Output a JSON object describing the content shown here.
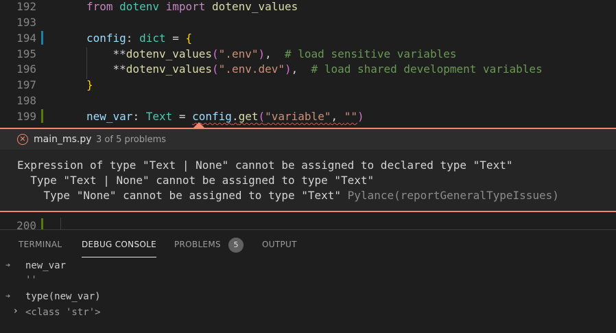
{
  "editor": {
    "lines": [
      {
        "num": "192",
        "tokens": [
          {
            "t": "from",
            "c": "kw"
          },
          {
            "t": " "
          },
          {
            "t": "dotenv",
            "c": "mod"
          },
          {
            "t": " "
          },
          {
            "t": "import",
            "c": "kw"
          },
          {
            "t": " "
          },
          {
            "t": "dotenv_values",
            "c": "fn"
          }
        ]
      },
      {
        "num": "193",
        "tokens": []
      },
      {
        "num": "194",
        "tokens": [
          {
            "t": "config",
            "c": "var"
          },
          {
            "t": ": "
          },
          {
            "t": "dict",
            "c": "mod"
          },
          {
            "t": " = "
          },
          {
            "t": "{",
            "c": "brace"
          }
        ]
      },
      {
        "num": "195",
        "tokens": [
          {
            "t": "    **"
          },
          {
            "t": "dotenv_values",
            "c": "fn"
          },
          {
            "t": "(",
            "c": "paren"
          },
          {
            "t": "\".env\"",
            "c": "str"
          },
          {
            "t": ")",
            "c": "paren"
          },
          {
            "t": ",  "
          },
          {
            "t": "# load sensitive variables",
            "c": "cmt"
          }
        ]
      },
      {
        "num": "196",
        "tokens": [
          {
            "t": "    **"
          },
          {
            "t": "dotenv_values",
            "c": "fn"
          },
          {
            "t": "(",
            "c": "paren"
          },
          {
            "t": "\".env.dev\"",
            "c": "str"
          },
          {
            "t": ")",
            "c": "paren"
          },
          {
            "t": ",  "
          },
          {
            "t": "# load shared development variables",
            "c": "cmt"
          }
        ]
      },
      {
        "num": "197",
        "tokens": [
          {
            "t": "}",
            "c": "brace"
          }
        ]
      },
      {
        "num": "198",
        "tokens": []
      },
      {
        "num": "199",
        "tokens": [
          {
            "t": "new_var",
            "c": "var"
          },
          {
            "t": ": "
          },
          {
            "t": "Text",
            "c": "mod"
          },
          {
            "t": " = "
          },
          {
            "t": "config",
            "c": "var squiggle"
          },
          {
            "t": ".",
            "c": "op squiggle"
          },
          {
            "t": "get",
            "c": "fn squiggle"
          },
          {
            "t": "(",
            "c": "paren squiggle"
          },
          {
            "t": "\"variable\"",
            "c": "str squiggle"
          },
          {
            "t": ", ",
            "c": "op squiggle"
          },
          {
            "t": "\"\"",
            "c": "str squiggle"
          },
          {
            "t": ")",
            "c": "paren"
          }
        ]
      }
    ],
    "line_after_peek": "200"
  },
  "peek": {
    "file": "main_ms.py",
    "count": "3 of 5 problems",
    "messages": [
      "Expression of type \"Text | None\" cannot be assigned to declared type \"Text\"",
      "  Type \"Text | None\" cannot be assigned to type \"Text\"",
      "    Type \"None\" cannot be assigned to type \"Text\""
    ],
    "source": "Pylance(reportGeneralTypeIssues)",
    "icon": "error-circle-icon"
  },
  "panel": {
    "tabs": [
      {
        "label": "TERMINAL"
      },
      {
        "label": "DEBUG CONSOLE"
      },
      {
        "label": "PROBLEMS"
      },
      {
        "label": "OUTPUT"
      }
    ],
    "problems_badge": "5",
    "console": [
      {
        "input": "new_var",
        "output": "''"
      },
      {
        "input": "type(new_var)",
        "output": "<class 'str'>"
      }
    ]
  },
  "colors": {
    "error": "#f48771",
    "modified_gutter": "#1b81a8",
    "added_gutter": "#587c0c"
  }
}
